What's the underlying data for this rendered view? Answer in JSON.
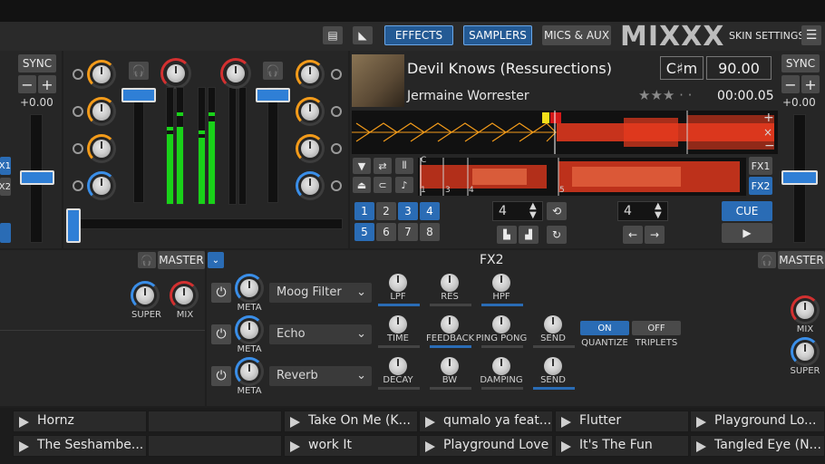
{
  "toolbar": {
    "effects": "EFFECTS",
    "samplers": "SAMPLERS",
    "mics_aux": "MICS & AUX",
    "logo": "MIXXX",
    "skin_settings": "SKIN SETTINGS"
  },
  "deck_left": {
    "sync": "SYNC",
    "pitch": "+0.00",
    "fx1": "X1",
    "fx2": "X2"
  },
  "deck_right": {
    "sync": "SYNC",
    "pitch": "+0.00",
    "fx1": "FX1",
    "fx2": "FX2"
  },
  "track": {
    "title": "Devil Knows (Ressurections)",
    "artist": "Jermaine Worrester",
    "key": "C♯m",
    "bpm": "90.00",
    "time": "00:00.05",
    "rating": "★★★ · ·"
  },
  "overview_markers": [
    "C",
    "1",
    "2",
    "3",
    "4",
    "5"
  ],
  "hotcues": [
    "1",
    "2",
    "3",
    "4",
    "5",
    "6",
    "7",
    "8"
  ],
  "loop": {
    "beats_a": "4",
    "beats_b": "4"
  },
  "cue": "CUE",
  "fx": {
    "header": "FX2",
    "master_left": "MASTER",
    "master_right": "MASTER",
    "super_left": "SUPER",
    "mix_left": "MIX",
    "mix_right": "MIX",
    "super_right": "SUPER",
    "units": [
      {
        "effect": "Moog Filter",
        "meta": "META",
        "params": [
          "LPF",
          "RES",
          "HPF"
        ]
      },
      {
        "effect": "Echo",
        "meta": "META",
        "params": [
          "TIME",
          "FEEDBACK",
          "PING PONG",
          "SEND"
        ]
      },
      {
        "effect": "Reverb",
        "meta": "META",
        "params": [
          "DECAY",
          "BW",
          "DAMPING",
          "SEND"
        ]
      }
    ],
    "quantize_on": "ON",
    "quantize": "QUANTIZE",
    "triplets_off": "OFF",
    "triplets": "TRIPLETS"
  },
  "library": {
    "row1": [
      "Hornz",
      "",
      "Take On Me (K...",
      "qumalo ya feat...",
      "Flutter",
      "Playground Lo..."
    ],
    "row2": [
      "The Seshambe...",
      "",
      "work It",
      "Playground Love",
      "It's The Fun",
      "Tangled Eye (N..."
    ]
  },
  "colors": {
    "accent": "#2a6cb5",
    "waveform": "#e83a1e",
    "vu": "#19d219"
  }
}
